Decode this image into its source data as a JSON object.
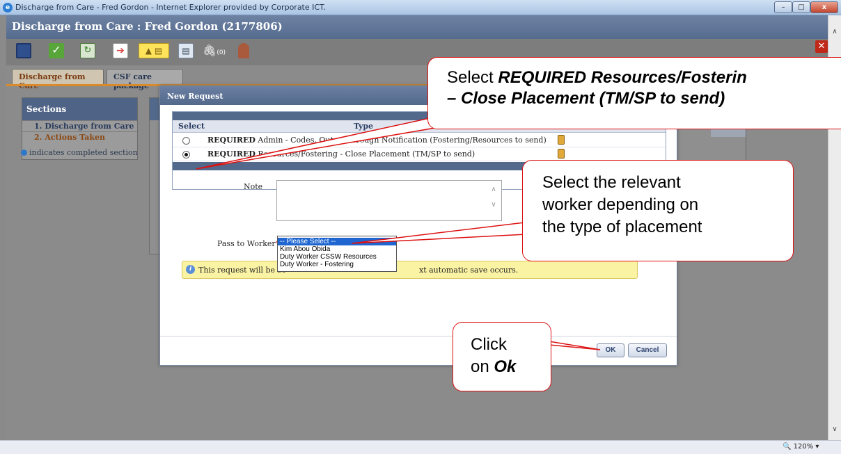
{
  "window": {
    "title": "Discharge from Care - Fred Gordon - Internet Explorer provided by Corporate ICT.",
    "controls": {
      "minimize": "–",
      "maximize": "□",
      "close": "x"
    }
  },
  "app": {
    "header_title": "Discharge from Care :  Fred Gordon  (2177806)"
  },
  "toolbar": {
    "attachments_count": "(0)",
    "icons": [
      "save-icon",
      "check-icon",
      "refresh-icon",
      "export-icon",
      "note-icon",
      "form-icon",
      "attachment-icon",
      "person-icon",
      "close-icon"
    ]
  },
  "tabs": [
    {
      "label": "Discharge from Care",
      "active": true
    },
    {
      "label": "CSF care package",
      "active": false
    }
  ],
  "sections": {
    "title": "Sections",
    "items": [
      {
        "label": "1.  Discharge from Care"
      },
      {
        "label": "2.  Actions Taken"
      }
    ],
    "legend": "indicates completed section"
  },
  "modal": {
    "title": "New Request",
    "table": {
      "col_select": "Select",
      "col_type": "Type",
      "rows": [
        {
          "bold": "REQUIRED",
          "text": " Admin - Codes, Out-of-Borough Notification (Fostering/Resources to send)",
          "selected": false
        },
        {
          "bold": "REQUIRED",
          "text": " Resources/Fostering - Close Placement (TM/SP to send)",
          "selected": true
        }
      ]
    },
    "note_label": "Note",
    "note_value": "",
    "pass_to_worker_label": "Pass to Worker",
    "required_mark": "*",
    "worker_options": [
      "-- Please Select --",
      "Kim Abou Obida",
      "Duty Worker CSSW Resources",
      "Duty Worker - Fostering"
    ],
    "worker_selected": "-- Please Select --",
    "info_text_a": "This request will be se",
    "info_text_b": "xt automatic save occurs.",
    "ok_label": "OK",
    "cancel_label": "Cancel"
  },
  "statusbar": {
    "zoom": "120%"
  },
  "callouts": {
    "c1_prefix": "Select ",
    "c1_bold_a": "REQUIRED Resources/Fosterin",
    "c1_bold_b": "– Close Placement (TM/SP to send)",
    "c2_line1": "Select the relevant",
    "c2_line2": "worker depending on",
    "c2_line3": "the type of placement",
    "c3_line1": "Click",
    "c3_on": "on ",
    "c3_bold": "Ok"
  },
  "colors": {
    "callout_border": "#dd1111",
    "header": "#53698c",
    "selection": "#1f66d1"
  }
}
